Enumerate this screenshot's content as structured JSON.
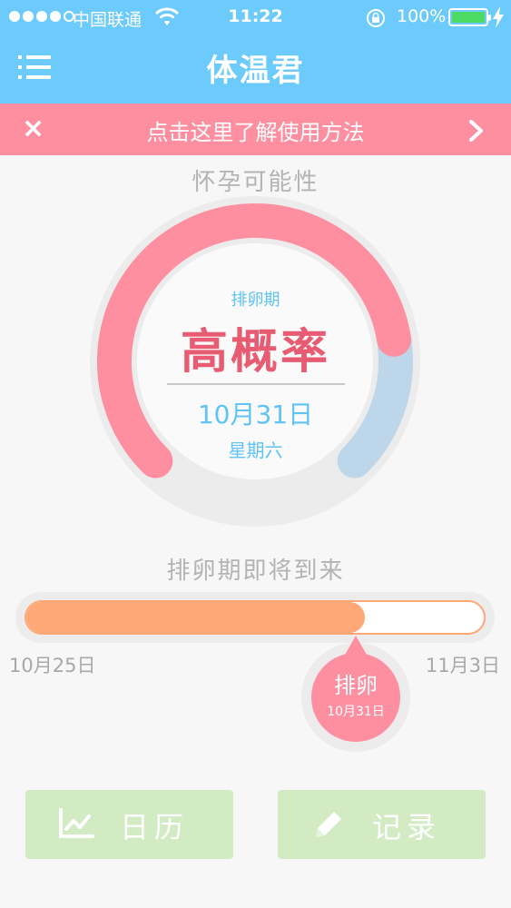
{
  "status_bar": {
    "carrier": "中国联通",
    "time": "11:22",
    "battery_percent": "100%"
  },
  "nav": {
    "title": "体温君",
    "icons": {
      "menu": "menu-icon"
    }
  },
  "banner": {
    "text": "点击这里了解使用方法",
    "icons": {
      "close": "close-icon",
      "next": "chevron-right-icon"
    }
  },
  "pregnancy": {
    "label": "怀孕可能性",
    "phase": "排卵期",
    "level": "高概率",
    "date": "10月31日",
    "weekday": "星期六",
    "gauge_fraction": 0.8
  },
  "cycle": {
    "label": "排卵期即将到来",
    "start_date": "10月25日",
    "end_date": "11月3日",
    "progress_fraction": 0.74,
    "marker_label": "排卵",
    "marker_date": "10月31日"
  },
  "actions": {
    "calendar_label": "日历",
    "record_label": "记录",
    "icons": {
      "calendar": "line-chart-icon",
      "record": "pencil-icon"
    }
  },
  "colors": {
    "header": "#6dcbfb",
    "banner": "#fe8fa0",
    "gauge_fill": "#fe8fa0",
    "gauge_rest": "#bdd6ea",
    "level_text": "#e85c73",
    "info_text": "#5fc3f5",
    "progress": "#ffa877",
    "buttons": "#d2ebc3"
  }
}
